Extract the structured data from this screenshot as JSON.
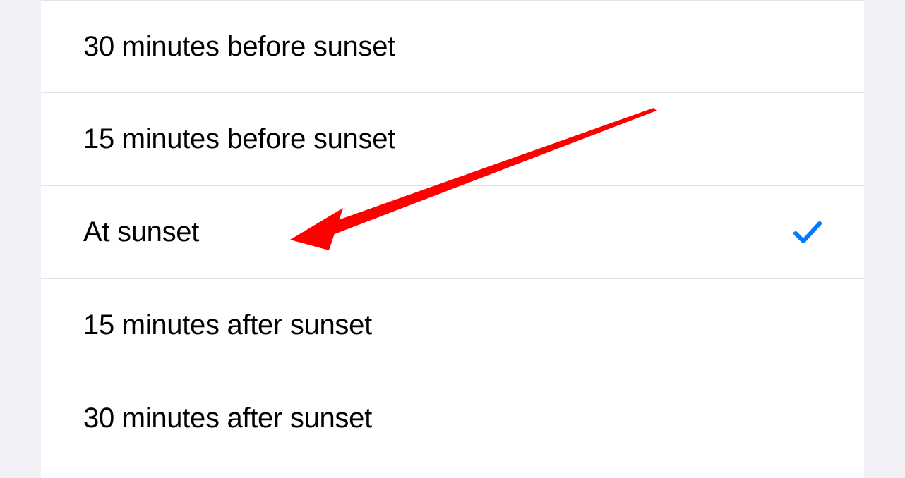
{
  "options": [
    {
      "label": "30 minutes before sunset",
      "selected": false
    },
    {
      "label": "15 minutes before sunset",
      "selected": false
    },
    {
      "label": "At sunset",
      "selected": true
    },
    {
      "label": "15 minutes after sunset",
      "selected": false
    },
    {
      "label": "30 minutes after sunset",
      "selected": false
    }
  ],
  "colors": {
    "checkmark": "#007aff",
    "arrow": "#ff0000"
  }
}
